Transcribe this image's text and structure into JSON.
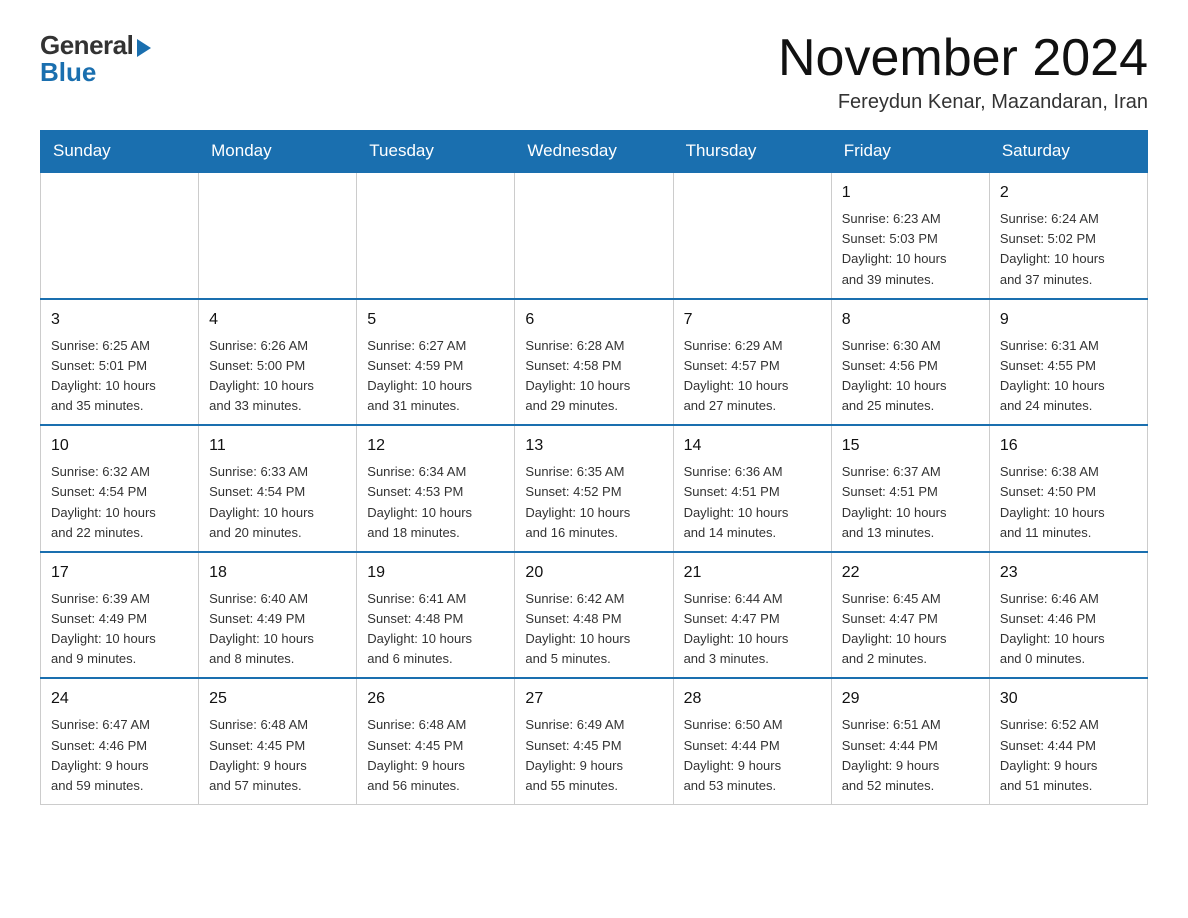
{
  "header": {
    "logo_general": "General",
    "logo_blue": "Blue",
    "month_title": "November 2024",
    "location": "Fereydun Kenar, Mazandaran, Iran"
  },
  "weekdays": [
    "Sunday",
    "Monday",
    "Tuesday",
    "Wednesday",
    "Thursday",
    "Friday",
    "Saturday"
  ],
  "rows": [
    [
      {
        "day": "",
        "info": ""
      },
      {
        "day": "",
        "info": ""
      },
      {
        "day": "",
        "info": ""
      },
      {
        "day": "",
        "info": ""
      },
      {
        "day": "",
        "info": ""
      },
      {
        "day": "1",
        "info": "Sunrise: 6:23 AM\nSunset: 5:03 PM\nDaylight: 10 hours\nand 39 minutes."
      },
      {
        "day": "2",
        "info": "Sunrise: 6:24 AM\nSunset: 5:02 PM\nDaylight: 10 hours\nand 37 minutes."
      }
    ],
    [
      {
        "day": "3",
        "info": "Sunrise: 6:25 AM\nSunset: 5:01 PM\nDaylight: 10 hours\nand 35 minutes."
      },
      {
        "day": "4",
        "info": "Sunrise: 6:26 AM\nSunset: 5:00 PM\nDaylight: 10 hours\nand 33 minutes."
      },
      {
        "day": "5",
        "info": "Sunrise: 6:27 AM\nSunset: 4:59 PM\nDaylight: 10 hours\nand 31 minutes."
      },
      {
        "day": "6",
        "info": "Sunrise: 6:28 AM\nSunset: 4:58 PM\nDaylight: 10 hours\nand 29 minutes."
      },
      {
        "day": "7",
        "info": "Sunrise: 6:29 AM\nSunset: 4:57 PM\nDaylight: 10 hours\nand 27 minutes."
      },
      {
        "day": "8",
        "info": "Sunrise: 6:30 AM\nSunset: 4:56 PM\nDaylight: 10 hours\nand 25 minutes."
      },
      {
        "day": "9",
        "info": "Sunrise: 6:31 AM\nSunset: 4:55 PM\nDaylight: 10 hours\nand 24 minutes."
      }
    ],
    [
      {
        "day": "10",
        "info": "Sunrise: 6:32 AM\nSunset: 4:54 PM\nDaylight: 10 hours\nand 22 minutes."
      },
      {
        "day": "11",
        "info": "Sunrise: 6:33 AM\nSunset: 4:54 PM\nDaylight: 10 hours\nand 20 minutes."
      },
      {
        "day": "12",
        "info": "Sunrise: 6:34 AM\nSunset: 4:53 PM\nDaylight: 10 hours\nand 18 minutes."
      },
      {
        "day": "13",
        "info": "Sunrise: 6:35 AM\nSunset: 4:52 PM\nDaylight: 10 hours\nand 16 minutes."
      },
      {
        "day": "14",
        "info": "Sunrise: 6:36 AM\nSunset: 4:51 PM\nDaylight: 10 hours\nand 14 minutes."
      },
      {
        "day": "15",
        "info": "Sunrise: 6:37 AM\nSunset: 4:51 PM\nDaylight: 10 hours\nand 13 minutes."
      },
      {
        "day": "16",
        "info": "Sunrise: 6:38 AM\nSunset: 4:50 PM\nDaylight: 10 hours\nand 11 minutes."
      }
    ],
    [
      {
        "day": "17",
        "info": "Sunrise: 6:39 AM\nSunset: 4:49 PM\nDaylight: 10 hours\nand 9 minutes."
      },
      {
        "day": "18",
        "info": "Sunrise: 6:40 AM\nSunset: 4:49 PM\nDaylight: 10 hours\nand 8 minutes."
      },
      {
        "day": "19",
        "info": "Sunrise: 6:41 AM\nSunset: 4:48 PM\nDaylight: 10 hours\nand 6 minutes."
      },
      {
        "day": "20",
        "info": "Sunrise: 6:42 AM\nSunset: 4:48 PM\nDaylight: 10 hours\nand 5 minutes."
      },
      {
        "day": "21",
        "info": "Sunrise: 6:44 AM\nSunset: 4:47 PM\nDaylight: 10 hours\nand 3 minutes."
      },
      {
        "day": "22",
        "info": "Sunrise: 6:45 AM\nSunset: 4:47 PM\nDaylight: 10 hours\nand 2 minutes."
      },
      {
        "day": "23",
        "info": "Sunrise: 6:46 AM\nSunset: 4:46 PM\nDaylight: 10 hours\nand 0 minutes."
      }
    ],
    [
      {
        "day": "24",
        "info": "Sunrise: 6:47 AM\nSunset: 4:46 PM\nDaylight: 9 hours\nand 59 minutes."
      },
      {
        "day": "25",
        "info": "Sunrise: 6:48 AM\nSunset: 4:45 PM\nDaylight: 9 hours\nand 57 minutes."
      },
      {
        "day": "26",
        "info": "Sunrise: 6:48 AM\nSunset: 4:45 PM\nDaylight: 9 hours\nand 56 minutes."
      },
      {
        "day": "27",
        "info": "Sunrise: 6:49 AM\nSunset: 4:45 PM\nDaylight: 9 hours\nand 55 minutes."
      },
      {
        "day": "28",
        "info": "Sunrise: 6:50 AM\nSunset: 4:44 PM\nDaylight: 9 hours\nand 53 minutes."
      },
      {
        "day": "29",
        "info": "Sunrise: 6:51 AM\nSunset: 4:44 PM\nDaylight: 9 hours\nand 52 minutes."
      },
      {
        "day": "30",
        "info": "Sunrise: 6:52 AM\nSunset: 4:44 PM\nDaylight: 9 hours\nand 51 minutes."
      }
    ]
  ]
}
